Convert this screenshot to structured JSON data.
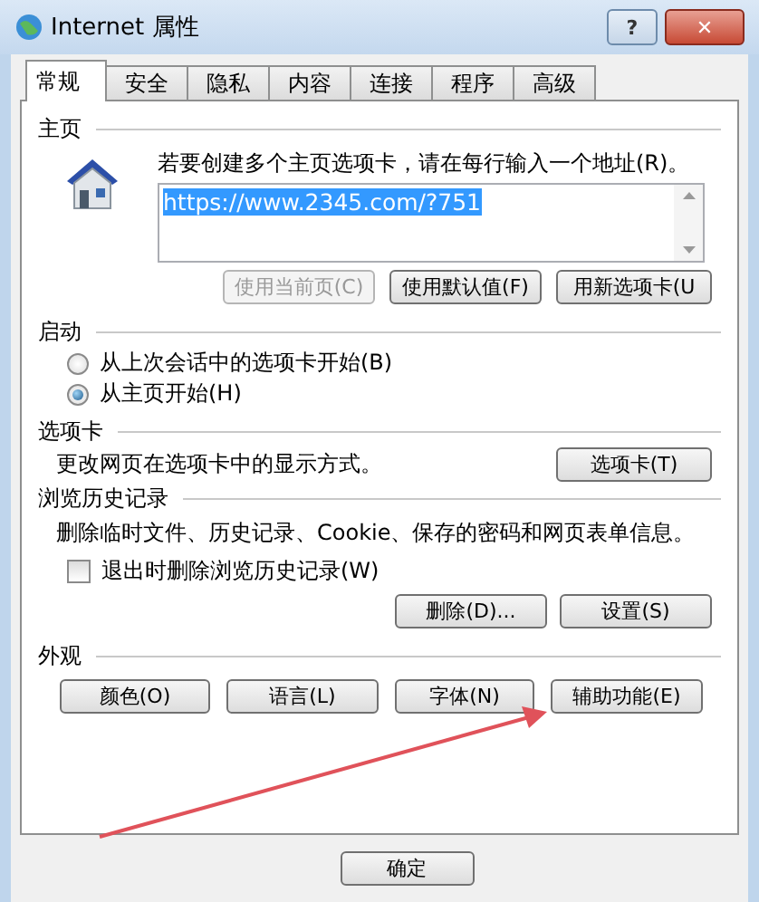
{
  "window": {
    "title": "Internet 属性",
    "buttons": [
      {
        "kind": "help",
        "label": "?"
      },
      {
        "kind": "close",
        "label": "✕"
      }
    ]
  },
  "tabs": [
    {
      "label": "常规",
      "selected": true
    },
    {
      "label": "安全",
      "selected": false
    },
    {
      "label": "隐私",
      "selected": false
    },
    {
      "label": "内容",
      "selected": false
    },
    {
      "label": "连接",
      "selected": false
    },
    {
      "label": "程序",
      "selected": false
    },
    {
      "label": "高级",
      "selected": false
    }
  ],
  "home_page": {
    "title": "主页",
    "hint": "若要创建多个主页选项卡，请在每行输入一个地址(R)。",
    "field": {
      "value": "https://www.2345.com/?751",
      "selected": true
    },
    "buttons": [
      {
        "label": "使用当前页(C)",
        "disabled": true
      },
      {
        "label": "使用默认值(F)",
        "disabled": false
      },
      {
        "label": "用新选项卡(U",
        "disabled": false
      }
    ]
  },
  "startup": {
    "title": "启动",
    "options": [
      {
        "label": "从上次会话中的选项卡开始(B)",
        "selected": false
      },
      {
        "label": "从主页开始(H)",
        "selected": true
      }
    ]
  },
  "tabs_section": {
    "title": "选项卡",
    "description": "更改网页在选项卡中的显示方式。",
    "button": "选项卡(T)"
  },
  "history": {
    "title": "浏览历史记录",
    "description": "删除临时文件、历史记录、Cookie、保存的密码和网页表单信息。",
    "checkbox": {
      "label": "退出时删除浏览历史记录(W)",
      "checked": false
    },
    "buttons": [
      "删除(D)...",
      "设置(S)"
    ]
  },
  "appearance": {
    "title": "外观",
    "buttons": [
      "颜色(O)",
      "语言(L)",
      "字体(N)",
      "辅助功能(E)"
    ]
  },
  "footer": {
    "buttons": [
      "确定"
    ]
  },
  "annotations": [
    {
      "kind": "arrow"
    }
  ]
}
